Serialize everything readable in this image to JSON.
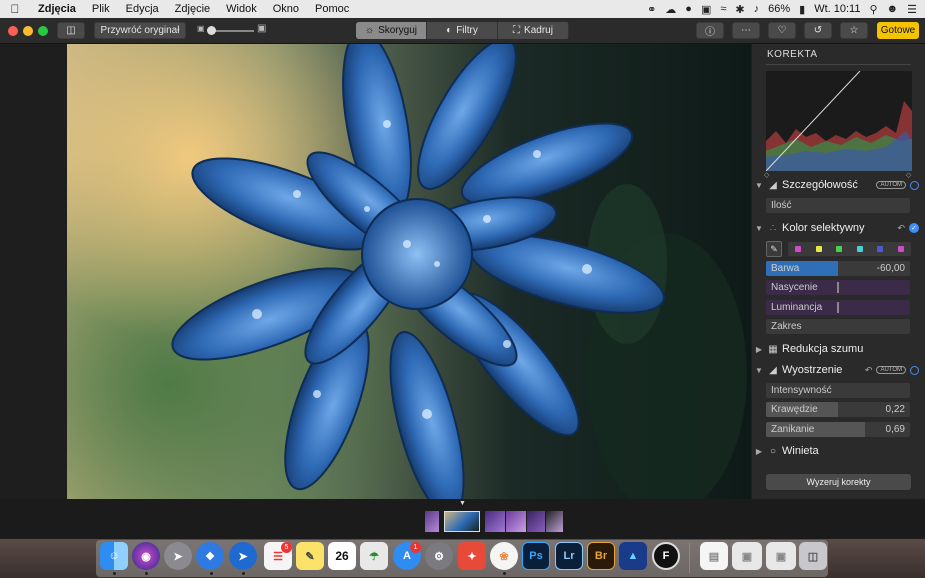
{
  "menubar": {
    "apple": "",
    "items": [
      "Zdjęcia",
      "Plik",
      "Edycja",
      "Zdjęcie",
      "Widok",
      "Okno",
      "Pomoc"
    ],
    "battery": "66%",
    "clock": "Wt. 10:11"
  },
  "toolbar": {
    "revert_label": "Przywróć oryginał",
    "tabs": [
      "Skoryguj",
      "Filtry",
      "Kadruj"
    ],
    "active_tab": "Skoryguj",
    "done_label": "Gotowe"
  },
  "panel": {
    "title": "KOREKTA",
    "detail": {
      "label": "Szczegółowość",
      "auto": "AUTOM",
      "amount_label": "Ilość"
    },
    "selective_color": {
      "label": "Kolor selektywny",
      "swatches": [
        "#d04ad0",
        "#e8e84a",
        "#4ad04a",
        "#4ad0d0",
        "#4a5ad0",
        "#d04ad0"
      ],
      "hue_label": "Barwa",
      "hue_value": "-60,00",
      "hue_fill": 0.5,
      "saturation_label": "Nasycenie",
      "luminance_label": "Luminancja",
      "range_label": "Zakres"
    },
    "noise_reduction": {
      "label": "Redukcja szumu"
    },
    "sharpen": {
      "label": "Wyostrzenie",
      "auto": "AUTOM",
      "intensity_label": "Intensywność",
      "edges_label": "Krawędzie",
      "edges_value": "0,22",
      "edges_fill": 0.5,
      "falloff_label": "Zanikanie",
      "falloff_value": "0,69",
      "falloff_fill": 0.69
    },
    "vignette": {
      "label": "Winieta"
    },
    "reset_label": "Wyzeruj korekty"
  },
  "dock": {
    "calendar_day": "26",
    "reminders_badge": "5",
    "appstore_badge": "1",
    "apps": [
      "Finder",
      "Siri",
      "Launchpad",
      "Safari",
      "Maps",
      "Reminders",
      "Notes",
      "Calendar",
      "Preview",
      "App Store",
      "System Preferences",
      "Airmail",
      "Photos",
      "Ps",
      "Lr",
      "Br",
      "Affinity",
      "F"
    ]
  },
  "colors": {
    "accent": "#f5c400",
    "hue_fill": "#2f6fb8",
    "purple_fill": "#4a2d5a",
    "selection": "#3d8ef5"
  }
}
